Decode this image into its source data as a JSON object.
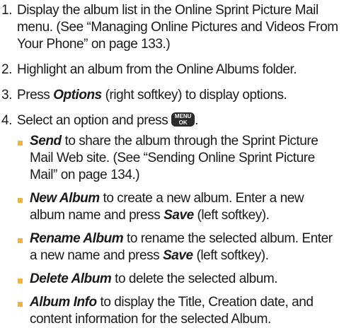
{
  "steps": [
    {
      "number": "1.",
      "text": "Display the album list in the Online Sprint Picture Mail menu. (See “Managing Online Pictures and Videos From Your Phone” on page 133.)"
    },
    {
      "number": "2.",
      "text": "Highlight an album from the Online Albums folder."
    },
    {
      "number": "3.",
      "before": "Press ",
      "term": "Options",
      "after": " (right softkey) to display options."
    },
    {
      "number": "4.",
      "before": "Select an option and press ",
      "key_top": "MENU",
      "key_bottom": "OK",
      "after": "."
    }
  ],
  "options": [
    {
      "term": "Send",
      "text": " to share the album through the Sprint Picture Mail Web site. (See “Sending Online Sprint Picture Mail” on page 134.)"
    },
    {
      "term": "New Album",
      "text": " to create a new album. Enter a new album name and press ",
      "term2": "Save",
      "text2": " (left softkey)."
    },
    {
      "term": "Rename Album",
      "text": " to rename the selected album. Enter a new name and press ",
      "term2": "Save",
      "text2": " (left softkey)."
    },
    {
      "term": "Delete Album",
      "text": " to delete the selected album."
    },
    {
      "term": "Album Info",
      "text": " to display the Title, Creation date, and content information for the selected Album."
    }
  ],
  "colors": {
    "bullet": "#f2b33d",
    "key_background": "#2b2b2b"
  },
  "icons": [
    "menu-ok-key-icon",
    "square-bullet-icon"
  ]
}
